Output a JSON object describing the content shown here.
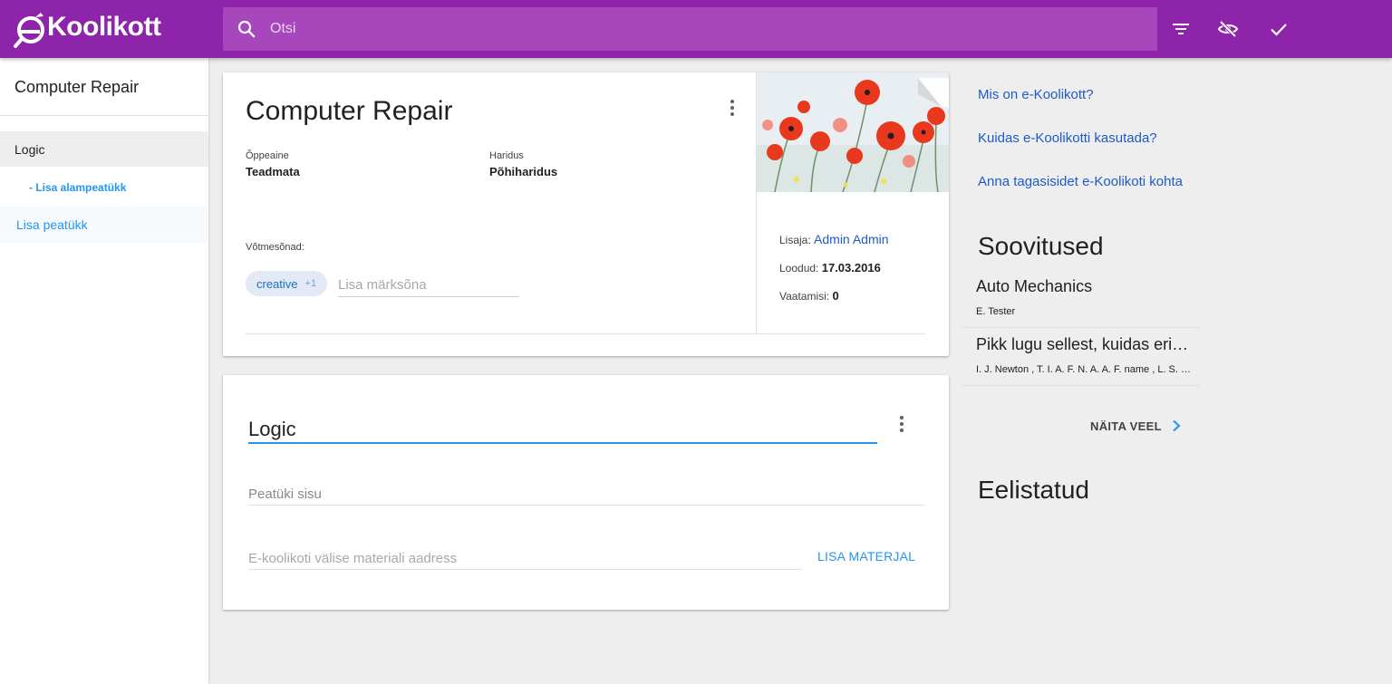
{
  "app": {
    "logo_text": "Koolikott"
  },
  "search": {
    "placeholder": "Otsi"
  },
  "toolbar": {
    "icons": [
      "filter-icon",
      "hidden-eye-icon",
      "check-icon"
    ]
  },
  "sidebar": {
    "title": "Computer Repair",
    "items": [
      {
        "label": "Logic",
        "active": true
      },
      {
        "label": "- Lisa alampeatükk"
      }
    ],
    "add_chapter": "Lisa peatükk"
  },
  "course": {
    "title": "Computer Repair",
    "subject_label": "Õppeaine",
    "subject_value": "Teadmata",
    "education_label": "Haridus",
    "education_value": "Põhiharidus",
    "keywords_label": "Võtmesõnad:",
    "keyword_chip": "creative",
    "keyword_extra": "+1",
    "keyword_placeholder": "Lisa märksõna",
    "added_by_label": "Lisaja:",
    "added_by_value": "Admin Admin",
    "created_label": "Loodud:",
    "created_value": "17.03.2016",
    "views_label": "Vaatamisi:",
    "views_value": "0"
  },
  "chapter": {
    "title_value": "Logic",
    "content_placeholder": "Peatüki sisu",
    "url_placeholder": "E-koolikoti välise materiali aadress",
    "add_material": "LISA MATERJAL"
  },
  "right": {
    "links": [
      "Mis on e-Koolikott?",
      "Kuidas e-Koolikotti kasutada?",
      "Anna tagasisidet e-Koolikoti kohta"
    ],
    "recommendations_heading": "Soovitused",
    "recommendations": [
      {
        "title": "Auto Mechanics",
        "author": "E. Tester"
      },
      {
        "title": "Pikk lugu sellest, kuidas erinevad asjad töötavad",
        "author": "I. J. Newton , T. I. A. F. N. A. A. F. name , L. S. Surname"
      }
    ],
    "show_more": "NÄITA VEEL",
    "preferred_heading": "Eelistatud"
  },
  "colors": {
    "primary": "#8e24aa",
    "accent": "#2196f3",
    "link": "#1e5ac8"
  }
}
